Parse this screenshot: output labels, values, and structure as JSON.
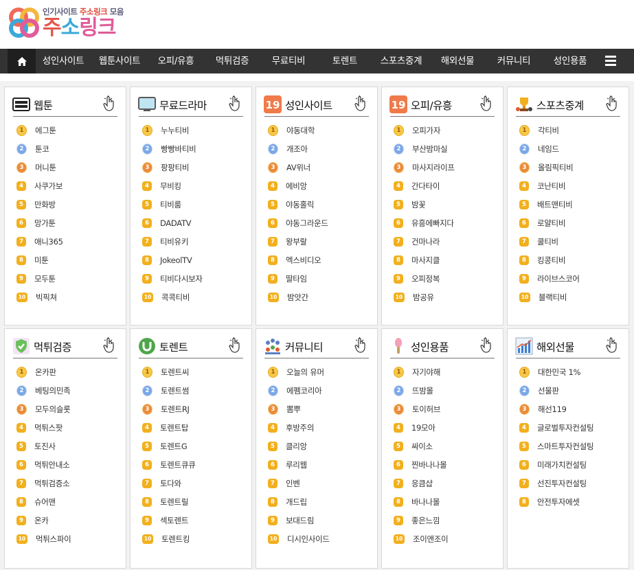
{
  "site": {
    "tagline_pre": "인기사이트",
    "tagline_hl": "주소링크",
    "tagline_post": "모음",
    "name_1": "주",
    "name_2": "소",
    "name_3": "링크"
  },
  "nav": {
    "home_icon": "home-icon",
    "items": [
      "성인사이트",
      "웹툰사이트",
      "오피/유흥",
      "먹튀검증",
      "무료티비",
      "토렌트",
      "스포츠중계",
      "해외선물",
      "커뮤니티",
      "성인용품"
    ],
    "menu_icon": "hamburger-icon"
  },
  "colors": {
    "nav_bg": "#333333",
    "home_bg": "#1f1f1f",
    "page_bg": "#f2f2f2",
    "medal_gold": "#f7c948",
    "medal_silver": "#7aa8e8",
    "medal_bronze": "#ea8b3c",
    "badge_orange": "#f2b01e"
  },
  "cards": [
    {
      "title": "웹툰",
      "icon": "webtoon-icon",
      "items": [
        "에그툰",
        "툰코",
        "머니툰",
        "사쿠가보",
        "만화방",
        "망가툰",
        "애니365",
        "미툰",
        "모두툰",
        "빅픽쳐"
      ]
    },
    {
      "title": "무료드라마",
      "icon": "tv-icon",
      "items": [
        "누누티비",
        "빵빵바티비",
        "팡팡티비",
        "무비킹",
        "티비룸",
        "DADATV",
        "티비유키",
        "JokeolTV",
        "티비다시보자",
        "콕콕티비"
      ]
    },
    {
      "title": "성인사이트",
      "icon": "age-19-icon",
      "items": [
        "야동대학",
        "개조아",
        "AV위너",
        "에비앙",
        "야동홀릭",
        "야동그라운드",
        "왕부랄",
        "엑스비디오",
        "딸타임",
        "밤앗간"
      ]
    },
    {
      "title": "오피/유흥",
      "icon": "age-19-icon",
      "items": [
        "오피가자",
        "부산밤마실",
        "마사지라이프",
        "간다타이",
        "밤꽃",
        "유흥에빠지다",
        "건마나라",
        "마사지클",
        "오피정복",
        "밤공유"
      ]
    },
    {
      "title": "스포츠중계",
      "icon": "trophy-icon",
      "items": [
        "각티비",
        "네임드",
        "올림픽티비",
        "코난티비",
        "배트맨티비",
        "로얄티비",
        "쿨티비",
        "킹콩티비",
        "라이브스코어",
        "블랙티비"
      ]
    },
    {
      "title": "먹튀검증",
      "icon": "shield-check-icon",
      "items": [
        "온카판",
        "베팅의민족",
        "모두의슬롯",
        "먹튀스팟",
        "토진사",
        "먹튀안내소",
        "먹튀검증소",
        "슈어맨",
        "온카",
        "먹튀스파이"
      ]
    },
    {
      "title": "토렌트",
      "icon": "utorrent-icon",
      "items": [
        "토렌트씨",
        "토렌트썸",
        "토렌트RJ",
        "토렌트탑",
        "토렌트G",
        "토렌트큐큐",
        "토다와",
        "토렌트릴",
        "섹토렌트",
        "토렌트킹"
      ]
    },
    {
      "title": "커뮤니티",
      "icon": "community-icon",
      "items": [
        "오늘의 유머",
        "에펨코리아",
        "뽐뿌",
        "후방주의",
        "클리앙",
        "루리웹",
        "인벤",
        "개드립",
        "보대드림",
        "디시인사이드"
      ]
    },
    {
      "title": "성인용품",
      "icon": "toy-icon",
      "items": [
        "자기야해",
        "뜨밤몰",
        "토이허브",
        "19모아",
        "싸이소",
        "찐바나나몰",
        "응큼샵",
        "바나나몰",
        "좋은느낌",
        "조이앤조이"
      ]
    },
    {
      "title": "해외선물",
      "icon": "chart-icon",
      "items": [
        "대한민국 1%",
        "선물판",
        "해선119",
        "글로벌투자컨설팅",
        "스마트투자컨설팅",
        "미래가치컨설팅",
        "선진투자컨설팅",
        "안전투자에셋"
      ]
    }
  ]
}
